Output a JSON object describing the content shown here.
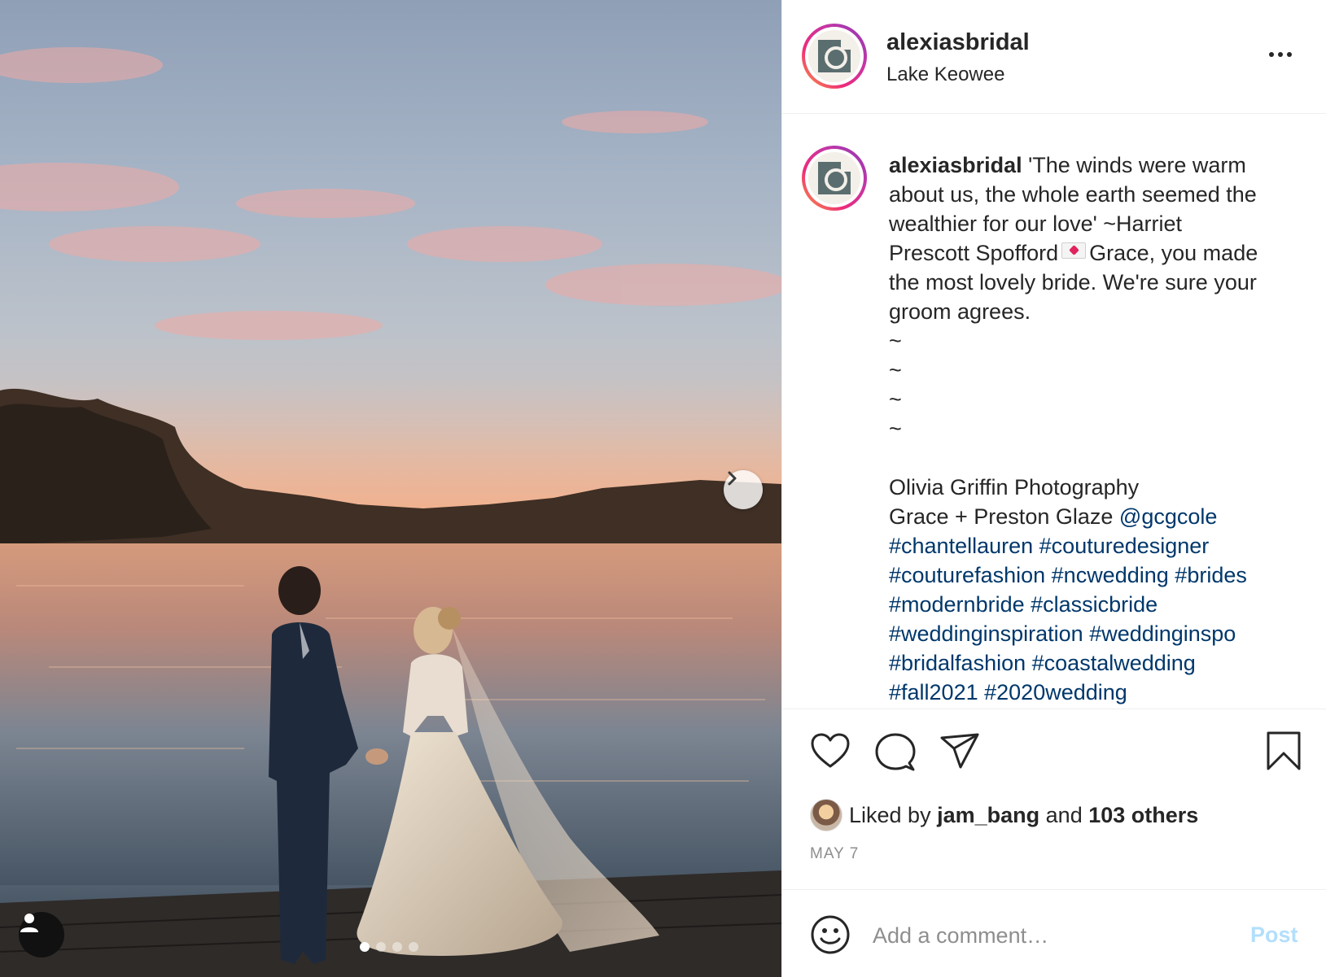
{
  "post": {
    "username": "alexiasbridal",
    "location": "Lake Keowee",
    "caption": {
      "username": "alexiasbridal",
      "lines": [
        "'The winds were warm",
        "about us, the whole earth seemed the",
        "wealthier for our love' ~Harriet",
        "Prescott Spofford",
        "Grace, you made",
        "the most lovely bride. We're sure your",
        "groom agrees.",
        "~",
        "~",
        "~",
        "~",
        "Olivia Griffin Photography",
        "Grace + Preston Glaze"
      ],
      "mention": "@gcgcole",
      "hashtags": [
        "#chantellauren",
        "#couturedesigner",
        "#couturefashion",
        "#ncwedding",
        "#brides",
        "#modernbride",
        "#classicbride",
        "#weddinginspiration",
        "#weddinginspo",
        "#bridalfashion",
        "#coastalwedding",
        "#fall2021",
        "#2020wedding"
      ],
      "emoji": "love-letter-emoji"
    },
    "likes": {
      "prefix": "Liked by",
      "user": "jam_bang",
      "joiner": "and",
      "others": "103 others"
    },
    "date": "MAY 7"
  },
  "comment_box": {
    "placeholder": "Add a comment…",
    "post_label": "Post"
  },
  "carousel": {
    "slide_count": 4,
    "active_index": 0
  },
  "icons": {
    "more": "more-options-icon",
    "like": "heart-icon",
    "comment": "comment-bubble-icon",
    "share": "paper-plane-icon",
    "save": "bookmark-icon",
    "emoji": "smiley-icon",
    "next": "chevron-right-icon",
    "tag": "user-tag-icon"
  },
  "colors": {
    "link": "#00376b",
    "post_button_disabled": "#b2dffc",
    "muted": "#8e8e8e"
  }
}
